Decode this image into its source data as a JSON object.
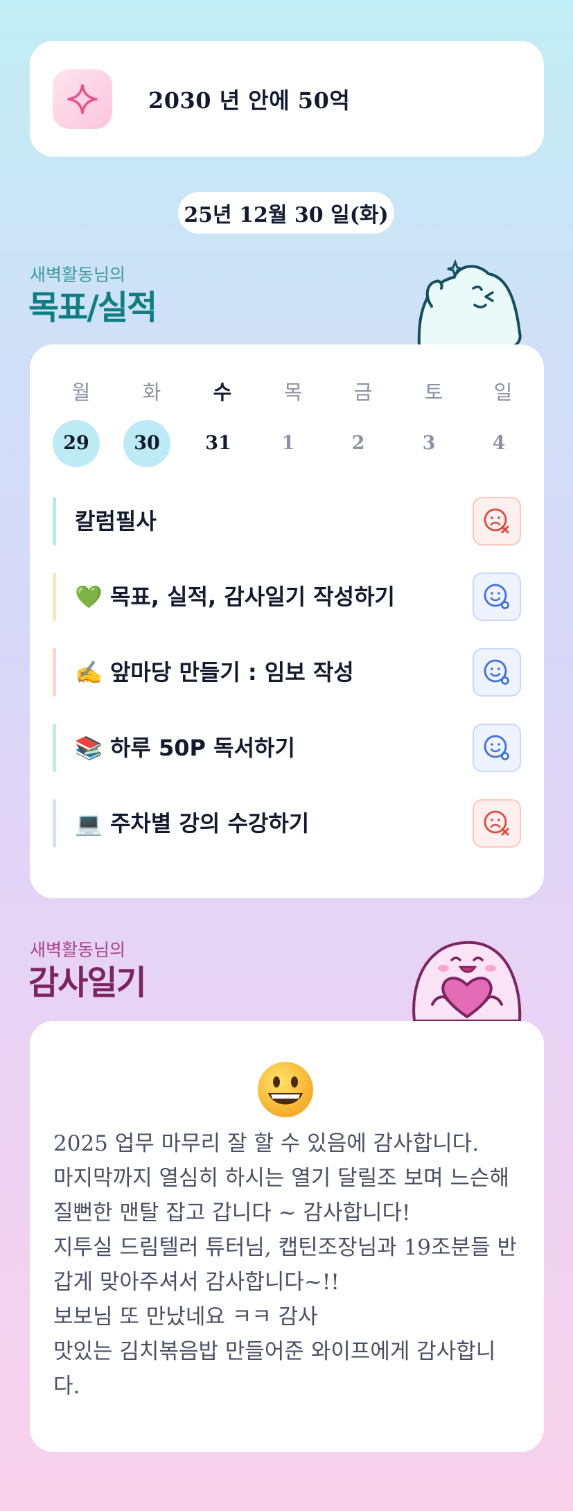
{
  "goal": {
    "icon": "sparkle-icon",
    "text": "2030 년 안에 50억"
  },
  "date": "25년 12월 30 일(화)",
  "goals_section": {
    "subtitle": "새벽활동님의",
    "title": "목표/실적"
  },
  "week": {
    "days": [
      "월",
      "화",
      "수",
      "목",
      "금",
      "토",
      "일"
    ],
    "dates": [
      "29",
      "30",
      "31",
      "1",
      "2",
      "3",
      "4"
    ],
    "completed": [
      0,
      1
    ],
    "today_index": 2
  },
  "items": [
    {
      "label": "칼럼필사",
      "bar_color": "#b6e7f3",
      "status": "fail"
    },
    {
      "label": "💚 목표, 실적, 감사일기 작성하기",
      "bar_color": "#fbe2bd",
      "status": "ok"
    },
    {
      "label": "✍️ 앞마당 만들기 : 임보 작성",
      "bar_color": "#fbd4d0",
      "status": "ok"
    },
    {
      "label": "📚 하루 50P 독서하기",
      "bar_color": "#bdeed6",
      "status": "ok"
    },
    {
      "label": "💻 주차별 강의 수강하기",
      "bar_color": "#d4e0f3",
      "status": "fail"
    }
  ],
  "gratitude_section": {
    "subtitle": "새벽활동님의",
    "title": "감사일기"
  },
  "gratitude": {
    "emoji": "grinning-face",
    "text": "2025 업무 마무리 잘 할 수 있음에 감사합니다.\n마지막까지 열심히 하시는 열기 달릴조 보며 느슨해\n질뻔한 맨탈 잡고 갑니다 ~ 감사합니다!\n지투실 드림텔러 튜터님, 캡틴조장님과 19조분들 반\n갑게 맞아주셔서 감사합니다~!!\n보보님 또 만났네요 ㅋㅋ 감사\n맛있는 김치볶음밥 만들어준 와이프에게 감사합니\n다."
  },
  "colors": {
    "fail": "#e0493a",
    "ok": "#3f6fe0",
    "completed_date_bg": "#bcebf5",
    "goals_title": "#0f7e82",
    "gratitude_title": "#7c2461"
  }
}
